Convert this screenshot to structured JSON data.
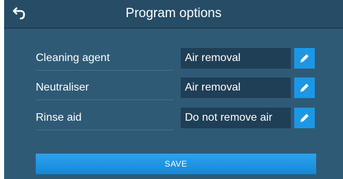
{
  "header": {
    "title": "Program options",
    "back_icon": "back-arrow-icon"
  },
  "options": [
    {
      "label": "Cleaning agent",
      "value": "Air removal",
      "edit_icon": "pencil-icon"
    },
    {
      "label": "Neutraliser",
      "value": "Air removal",
      "edit_icon": "pencil-icon"
    },
    {
      "label": "Rinse aid",
      "value": "Do not remove air",
      "edit_icon": "pencil-icon"
    }
  ],
  "save_button": {
    "label": "SAVE"
  },
  "colors": {
    "background": "#2f5a76",
    "header": "#264c66",
    "field": "#1f3f56",
    "accent": "#1c97e6"
  }
}
